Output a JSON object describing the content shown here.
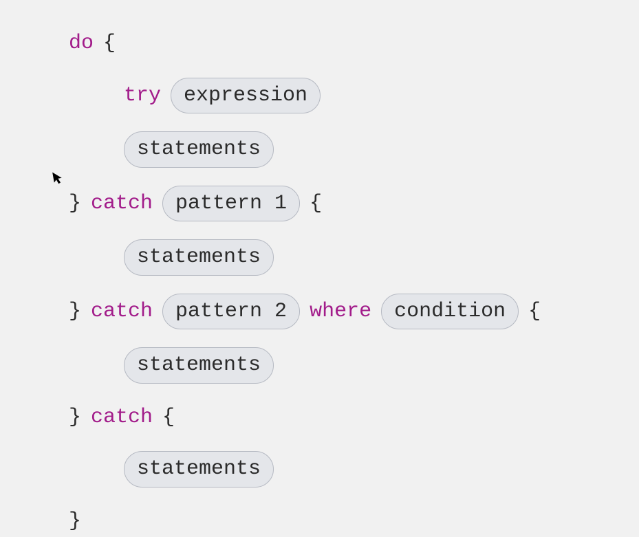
{
  "keywords": {
    "do": "do",
    "try": "try",
    "catch1": "catch",
    "catch2": "catch",
    "catch3": "catch",
    "where": "where"
  },
  "braces": {
    "open1": "{",
    "close_open1": "}",
    "open2": "{",
    "close_open2": "}",
    "open3": "{",
    "close_open3": "}",
    "open4": "{",
    "close4": "}"
  },
  "placeholders": {
    "expression": "expression",
    "statements1": "statements",
    "pattern1": "pattern 1",
    "statements2": "statements",
    "pattern2": "pattern 2",
    "condition": "condition",
    "statements3": "statements",
    "statements4": "statements"
  }
}
